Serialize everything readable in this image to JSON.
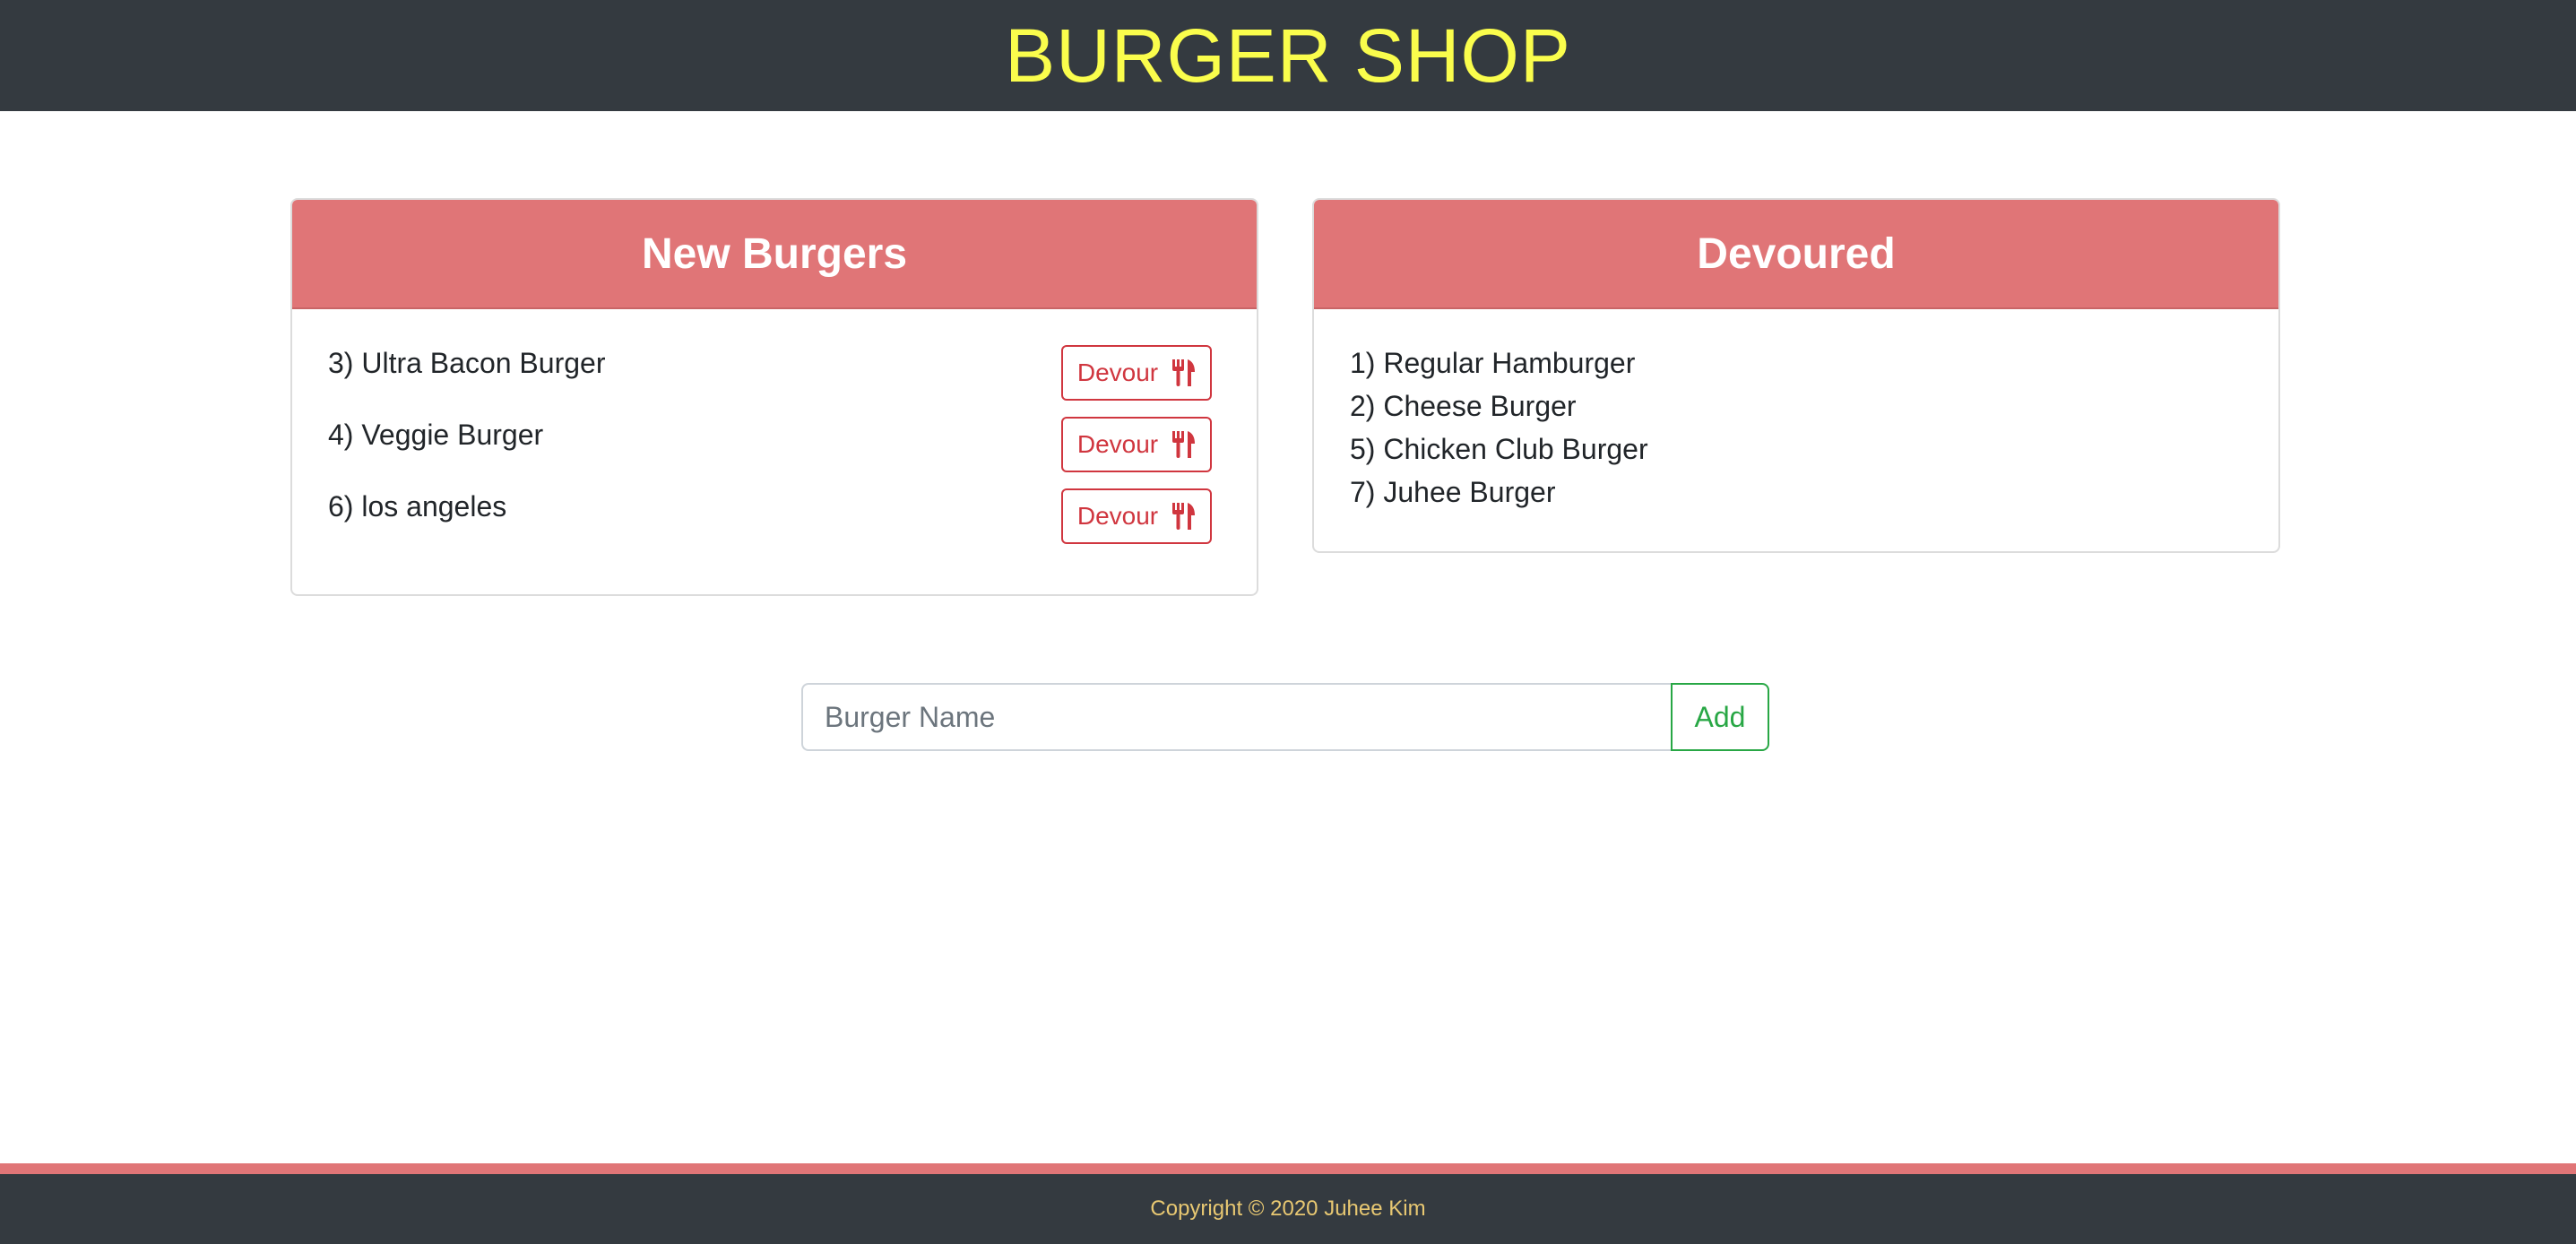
{
  "header": {
    "title": "BURGER SHOP"
  },
  "new_burgers": {
    "title": "New Burgers",
    "items": [
      {
        "label": "3) Ultra Bacon Burger",
        "button_label": "Devour"
      },
      {
        "label": "4) Veggie Burger",
        "button_label": "Devour"
      },
      {
        "label": "6) los angeles",
        "button_label": "Devour"
      }
    ],
    "button_icon": "utensils-icon"
  },
  "devoured": {
    "title": "Devoured",
    "items": [
      {
        "label": "1) Regular Hamburger"
      },
      {
        "label": "2) Cheese Burger"
      },
      {
        "label": "5) Chicken Club Burger"
      },
      {
        "label": "7) Juhee Burger"
      }
    ]
  },
  "add_form": {
    "input_value": "",
    "input_placeholder": "Burger Name",
    "add_label": "Add"
  },
  "footer": {
    "copyright": "Copyright © 2020 Juhee Kim"
  },
  "colors": {
    "header_bg": "#343a40",
    "title_yellow": "#fafd4c",
    "card_header": "#e07577",
    "devour_red": "#d0363f",
    "add_green": "#28a745",
    "footer_text": "#e8c872"
  }
}
